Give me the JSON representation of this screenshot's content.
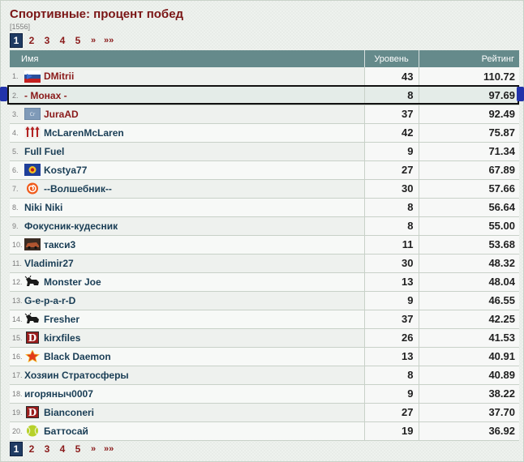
{
  "header": {
    "title": "Спортивные: процент побед",
    "total": "[1556]"
  },
  "pager": [
    "1",
    "2",
    "3",
    "4",
    "5",
    "»",
    "»»"
  ],
  "table": {
    "columns": {
      "name": "Имя",
      "level": "Уровень",
      "rating": "Рейтинг"
    },
    "rows": [
      {
        "rank": "1.",
        "name": "DMitrii",
        "level": "43",
        "rating": "110.72",
        "icon": "flag-icon",
        "color": "red"
      },
      {
        "rank": "2.",
        "name": "- Монах -",
        "level": "8",
        "rating": "97.69",
        "icon": "",
        "color": "red"
      },
      {
        "rank": "3.",
        "name": "JuraAD",
        "level": "37",
        "rating": "92.49",
        "icon": "clan-badge-icon",
        "color": "red"
      },
      {
        "rank": "4.",
        "name": "McLarenMcLaren",
        "level": "42",
        "rating": "75.87",
        "icon": "arrows-icon",
        "color": "blue"
      },
      {
        "rank": "5.",
        "name": "Full Fuel",
        "level": "9",
        "rating": "71.34",
        "icon": "",
        "color": "blue"
      },
      {
        "rank": "6.",
        "name": "Kostya77",
        "level": "27",
        "rating": "67.89",
        "icon": "emblem-icon",
        "color": "blue"
      },
      {
        "rank": "7.",
        "name": "--Волшебник--",
        "level": "30",
        "rating": "57.66",
        "icon": "swirl-icon",
        "color": "blue"
      },
      {
        "rank": "8.",
        "name": "Niki Niki",
        "level": "8",
        "rating": "56.64",
        "icon": "",
        "color": "blue"
      },
      {
        "rank": "9.",
        "name": "Фокусник-кудесник",
        "level": "8",
        "rating": "55.00",
        "icon": "",
        "color": "blue"
      },
      {
        "rank": "10.",
        "name": "такси3",
        "level": "11",
        "rating": "53.68",
        "icon": "car-icon",
        "color": "blue"
      },
      {
        "rank": "11.",
        "name": "Vladimir27",
        "level": "30",
        "rating": "48.32",
        "icon": "",
        "color": "blue"
      },
      {
        "rank": "12.",
        "name": "Monster Joe",
        "level": "13",
        "rating": "48.04",
        "icon": "bull-icon",
        "color": "blue"
      },
      {
        "rank": "13.",
        "name": "G-e-p-a-r-D",
        "level": "9",
        "rating": "46.55",
        "icon": "",
        "color": "blue"
      },
      {
        "rank": "14.",
        "name": "Fresher",
        "level": "37",
        "rating": "42.25",
        "icon": "bull-icon",
        "color": "blue"
      },
      {
        "rank": "15.",
        "name": "kirxfiles",
        "level": "26",
        "rating": "41.53",
        "icon": "letter-d-icon",
        "color": "blue"
      },
      {
        "rank": "16.",
        "name": "Black Daemon",
        "level": "13",
        "rating": "40.91",
        "icon": "star-icon",
        "color": "blue"
      },
      {
        "rank": "17.",
        "name": "Хозяин Стратосферы",
        "level": "8",
        "rating": "40.89",
        "icon": "",
        "color": "blue"
      },
      {
        "rank": "18.",
        "name": "игоряныч0007",
        "level": "9",
        "rating": "38.22",
        "icon": "",
        "color": "blue"
      },
      {
        "rank": "19.",
        "name": "Bianconeri",
        "level": "27",
        "rating": "37.70",
        "icon": "letter-d-icon",
        "color": "blue"
      },
      {
        "rank": "20.",
        "name": "Баттосай",
        "level": "19",
        "rating": "36.92",
        "icon": "tennis-ball-icon",
        "color": "blue"
      }
    ]
  },
  "colors": {
    "title": "#7a1515",
    "header_bg": "#658a8b",
    "link": "#193d55",
    "link_red": "#8a1a1a",
    "page_active": "#1f3b63"
  }
}
